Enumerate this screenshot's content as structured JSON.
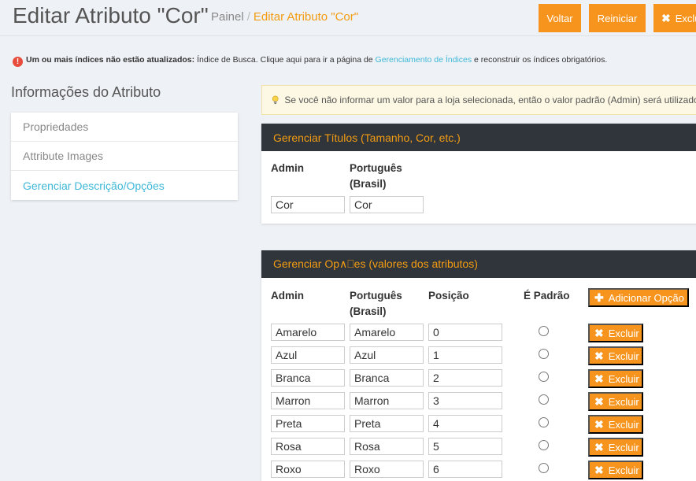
{
  "header": {
    "title": "Editar Atributo \"Cor\"",
    "breadcrumb_home": "Painel",
    "breadcrumb_sep": "/",
    "breadcrumb_current": "Editar Atributo \"Cor\"",
    "back_label": "Voltar",
    "reset_label": "Reiniciar",
    "delete_label": "Excluir"
  },
  "notice": {
    "bold": "Um ou mais índices não estão atualizados:",
    "text1": " Índice de Busca. Clique aqui para ir a página de ",
    "link": "Gerenciamento de Índices",
    "text2": " e reconstruir os índices obrigatórios."
  },
  "sidebar": {
    "title": "Informações do Atributo",
    "items": [
      {
        "label": "Propriedades",
        "active": false
      },
      {
        "label": "Attribute Images",
        "active": false
      },
      {
        "label": "Gerenciar Descrição/Opções",
        "active": true
      }
    ]
  },
  "hint": "Se você não informar um valor para a loja selecionada, então o valor padrão (Admin) será utilizado.",
  "titles_panel": {
    "heading": "Gerenciar Títulos (Tamanho, Cor, etc.)",
    "col_admin": "Admin",
    "col_pt_1": "Português",
    "col_pt_2": "(Brasil)",
    "admin_value": "Cor",
    "pt_value": "Cor"
  },
  "options_panel": {
    "heading": "Gerenciar Op∧⎕es (valores dos atributos)",
    "col_admin": "Admin",
    "col_pt_1": "Português",
    "col_pt_2": "(Brasil)",
    "col_position": "Posição",
    "col_default": "É Padrão",
    "add_label": "Adicionar Opção",
    "delete_label": "Excluir",
    "rows": [
      {
        "admin": "Amarelo",
        "pt": "Amarelo",
        "position": "0"
      },
      {
        "admin": "Azul",
        "pt": "Azul",
        "position": "1"
      },
      {
        "admin": "Branca",
        "pt": "Branca",
        "position": "2"
      },
      {
        "admin": "Marron",
        "pt": "Marron",
        "position": "3"
      },
      {
        "admin": "Preta",
        "pt": "Preta",
        "position": "4"
      },
      {
        "admin": "Rosa",
        "pt": "Rosa",
        "position": "5"
      },
      {
        "admin": "Roxo",
        "pt": "Roxo",
        "position": "6"
      }
    ]
  },
  "colors": {
    "accent": "#f7941d",
    "link": "#3fb8d8",
    "panel_head": "#2f353b",
    "error": "#e74c3c"
  }
}
